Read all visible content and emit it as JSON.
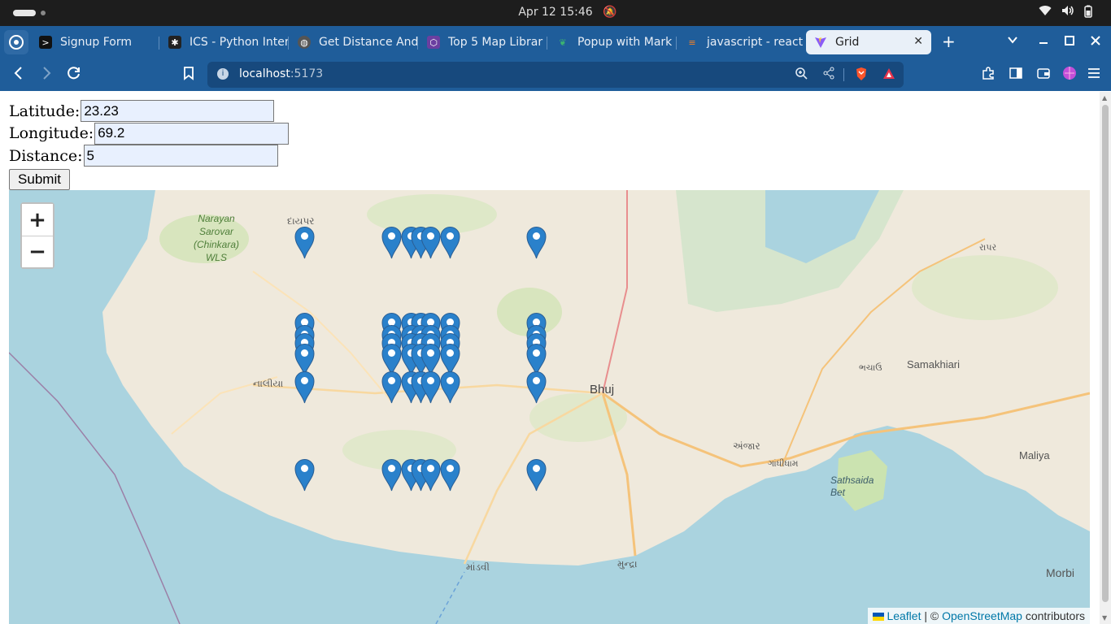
{
  "os": {
    "clock": "Apr 12  15:46"
  },
  "tabs": [
    {
      "label": "Signup Form",
      "icon": "terminal-icon",
      "fav_color": "#111111"
    },
    {
      "label": "ICS - Python Inter",
      "icon": "star-icon",
      "fav_color": "#222222"
    },
    {
      "label": "Get Distance And",
      "icon": "globe-icon",
      "fav_color": "#555555"
    },
    {
      "label": "Top 5 Map Librar",
      "icon": "cube-icon",
      "fav_color": "#6b3fa0"
    },
    {
      "label": "Popup with Mark",
      "icon": "leaf-icon",
      "fav_color": "#2e8b57"
    },
    {
      "label": "javascript - react",
      "icon": "stack-icon",
      "fav_color": "#f48024"
    },
    {
      "label": "Grid",
      "icon": "vite-icon",
      "fav_color": "#8b5cf6"
    }
  ],
  "address": {
    "host": "localhost",
    "port": ":5173"
  },
  "form": {
    "lat_label": "Latitude:",
    "lat_value": "23.23",
    "lng_label": "Longitude:",
    "lng_value": "69.2",
    "dist_label": "Distance:",
    "dist_value": "5",
    "submit_label": "Submit"
  },
  "map": {
    "zoom_in": "+",
    "zoom_out": "−",
    "attribution": {
      "leaflet": "Leaflet",
      "sep": " | © ",
      "osm": "OpenStreetMap",
      "tail": " contributors"
    },
    "places": {
      "bhuj": "Bhuj",
      "samakhiari": "Samakhiari",
      "maliya": "Maliya",
      "morbi": "Morbi",
      "sathsaida": "Sathsaida Bet",
      "narayan": "Narayan Sarovar (Chinkara) WLS",
      "dayapar": "દાયપર",
      "nalia": "નાલીયા",
      "mandvi": "માંડવી",
      "mundra": "મુન્દ્રા",
      "anjar": "અંજાર",
      "gandhidham": "ગાંધીધામ",
      "bhachau": "ભચાઉ",
      "rapar": "રાપર"
    },
    "marker_color": "#2a81cb",
    "markers": [
      {
        "col": 0,
        "row": 0
      },
      {
        "col": 1,
        "row": 0
      },
      {
        "col": 2,
        "row": 0
      },
      {
        "col": 3,
        "row": 0
      },
      {
        "col": 4,
        "row": 0
      },
      {
        "col": 5,
        "row": 0
      },
      {
        "col": 6,
        "row": 0
      },
      {
        "col": 0,
        "row": 1
      },
      {
        "col": 1,
        "row": 1
      },
      {
        "col": 2,
        "row": 1
      },
      {
        "col": 3,
        "row": 1
      },
      {
        "col": 4,
        "row": 1
      },
      {
        "col": 5,
        "row": 1
      },
      {
        "col": 6,
        "row": 1
      },
      {
        "col": 0,
        "row": 2
      },
      {
        "col": 1,
        "row": 2
      },
      {
        "col": 2,
        "row": 2
      },
      {
        "col": 3,
        "row": 2
      },
      {
        "col": 4,
        "row": 2
      },
      {
        "col": 5,
        "row": 2
      },
      {
        "col": 6,
        "row": 2
      },
      {
        "col": 0,
        "row": 3
      },
      {
        "col": 1,
        "row": 3
      },
      {
        "col": 2,
        "row": 3
      },
      {
        "col": 3,
        "row": 3
      },
      {
        "col": 4,
        "row": 3
      },
      {
        "col": 5,
        "row": 3
      },
      {
        "col": 6,
        "row": 3
      },
      {
        "col": 0,
        "row": 4
      },
      {
        "col": 1,
        "row": 4
      },
      {
        "col": 2,
        "row": 4
      },
      {
        "col": 3,
        "row": 4
      },
      {
        "col": 4,
        "row": 4
      },
      {
        "col": 5,
        "row": 4
      },
      {
        "col": 6,
        "row": 4
      },
      {
        "col": 0,
        "row": 5
      },
      {
        "col": 1,
        "row": 5
      },
      {
        "col": 2,
        "row": 5
      },
      {
        "col": 3,
        "row": 5
      },
      {
        "col": 4,
        "row": 5
      },
      {
        "col": 5,
        "row": 5
      },
      {
        "col": 6,
        "row": 5
      },
      {
        "col": 0,
        "row": 6
      },
      {
        "col": 1,
        "row": 6
      },
      {
        "col": 2,
        "row": 6
      },
      {
        "col": 3,
        "row": 6
      },
      {
        "col": 4,
        "row": 6
      },
      {
        "col": 5,
        "row": 6
      },
      {
        "col": 6,
        "row": 6
      }
    ]
  }
}
